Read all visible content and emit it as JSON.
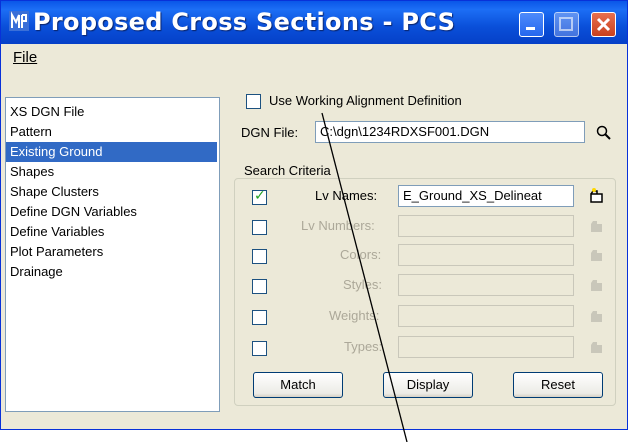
{
  "window": {
    "title": "Proposed Cross Sections - PCS"
  },
  "menubar": {
    "file": "File"
  },
  "sidebar": {
    "items": [
      {
        "label": "XS DGN File",
        "selected": false
      },
      {
        "label": "Pattern",
        "selected": false
      },
      {
        "label": "Existing Ground",
        "selected": true
      },
      {
        "label": "Shapes",
        "selected": false
      },
      {
        "label": "Shape Clusters",
        "selected": false
      },
      {
        "label": "Define DGN Variables",
        "selected": false
      },
      {
        "label": "Define Variables",
        "selected": false
      },
      {
        "label": "Plot Parameters",
        "selected": false
      },
      {
        "label": "Drainage",
        "selected": false
      }
    ]
  },
  "main": {
    "use_working_alignment": {
      "label": "Use Working Alignment Definition",
      "checked": false
    },
    "dgn_file": {
      "label": "DGN File:",
      "value": "C:\\dgn\\1234RDXSF001.DGN"
    },
    "search_criteria": {
      "title": "Search Criteria",
      "rows": [
        {
          "label": "Lv Names:",
          "value": "E_Ground_XS_Delineat",
          "checked": true,
          "enabled": true
        },
        {
          "label": "Lv Numbers:",
          "value": "",
          "checked": false,
          "enabled": false
        },
        {
          "label": "Colors:",
          "value": "",
          "checked": false,
          "enabled": false
        },
        {
          "label": "Styles:",
          "value": "",
          "checked": false,
          "enabled": false
        },
        {
          "label": "Weights:",
          "value": "",
          "checked": false,
          "enabled": false
        },
        {
          "label": "Types:",
          "value": "",
          "checked": false,
          "enabled": false
        }
      ]
    },
    "buttons": {
      "match": "Match",
      "display": "Display",
      "reset": "Reset"
    }
  },
  "colors": {
    "titlebar": "#0a56e8",
    "selection": "#316ac5",
    "window_bg": "#ece9d8"
  },
  "icons": {
    "app": "app-logo-icon",
    "search": "magnifier-icon",
    "pick": "element-pick-icon"
  }
}
